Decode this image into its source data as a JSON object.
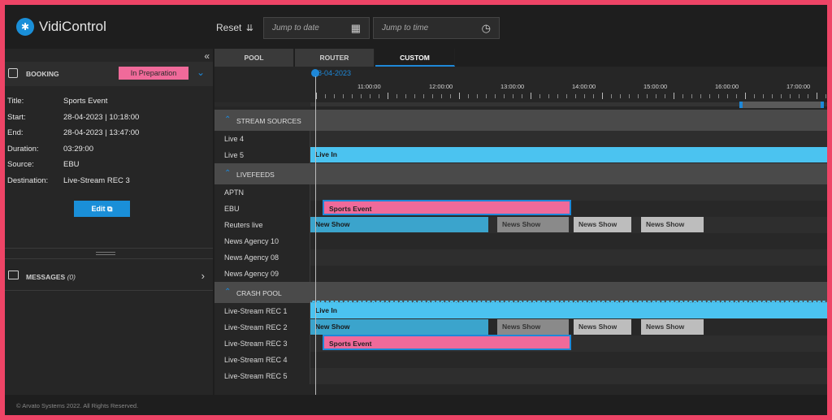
{
  "app": {
    "title": "VidiControl"
  },
  "header": {
    "reset_label": "Reset",
    "jump_date_placeholder": "Jump to date",
    "jump_time_placeholder": "Jump to time"
  },
  "booking": {
    "section_label": "BOOKING",
    "status": "In Preparation",
    "fields": [
      {
        "key": "Title:",
        "value": "Sports Event"
      },
      {
        "key": "Start:",
        "value": "28-04-2023 | 10:18:00"
      },
      {
        "key": "End:",
        "value": "28-04-2023 | 13:47:00"
      },
      {
        "key": "Duration:",
        "value": "03:29:00"
      },
      {
        "key": "Source:",
        "value": "EBU"
      },
      {
        "key": "Destination:",
        "value": "Live-Stream REC 3"
      }
    ],
    "edit_label": "Edit"
  },
  "messages": {
    "label": "MESSAGES",
    "count": "(0)"
  },
  "footer": {
    "copyright": "© Arvato Systems 2022. All Rights Reserved."
  },
  "tabs": [
    {
      "label": "POOL",
      "active": false
    },
    {
      "label": "ROUTER",
      "active": false
    },
    {
      "label": "CUSTOM",
      "active": true
    }
  ],
  "timeline": {
    "date_label": "28-04-2023",
    "hours": [
      "11:00:00",
      "12:00:00",
      "13:00:00",
      "14:00:00",
      "15:00:00",
      "16:00:00",
      "17:00:00"
    ]
  },
  "groups": [
    {
      "title": "STREAM SOURCES",
      "rows": [
        {
          "label": "Live 4",
          "bars": []
        },
        {
          "label": "Live 5",
          "bars": [
            {
              "text": "Live In",
              "style": "blue"
            }
          ]
        }
      ]
    },
    {
      "title": "LIVEFEEDS",
      "rows": [
        {
          "label": "APTN",
          "bars": []
        },
        {
          "label": "EBU",
          "bars": [
            {
              "text": "Sports Event",
              "style": "pink"
            }
          ]
        },
        {
          "label": "Reuters live",
          "bars": [
            {
              "text": "New Show",
              "style": "blue2"
            },
            {
              "text": "News Show",
              "style": "grey2"
            },
            {
              "text": "News Show",
              "style": "grey"
            },
            {
              "text": "News Show",
              "style": "grey"
            }
          ]
        },
        {
          "label": "News Agency 10",
          "bars": []
        },
        {
          "label": "News Agency 08",
          "bars": []
        },
        {
          "label": "News Agency 09",
          "bars": []
        }
      ]
    },
    {
      "title": "CRASH POOL",
      "rows": [
        {
          "label": "Live-Stream REC 1",
          "bars": [
            {
              "text": "Live In",
              "style": "blue"
            }
          ]
        },
        {
          "label": "Live-Stream REC 2",
          "bars": [
            {
              "text": "New Show",
              "style": "blue2"
            },
            {
              "text": "News Show",
              "style": "grey2"
            },
            {
              "text": "News Show",
              "style": "grey"
            },
            {
              "text": "News Show",
              "style": "grey"
            }
          ]
        },
        {
          "label": "Live-Stream REC 3",
          "bars": [
            {
              "text": "Sports Event",
              "style": "pink"
            }
          ]
        },
        {
          "label": "Live-Stream REC 4",
          "bars": []
        },
        {
          "label": "Live-Stream REC 5",
          "bars": []
        }
      ]
    }
  ],
  "colors": {
    "accent": "#1e88d8",
    "frame": "#ee4466",
    "live": "#4bc3f0",
    "booking": "#f06a9a"
  }
}
